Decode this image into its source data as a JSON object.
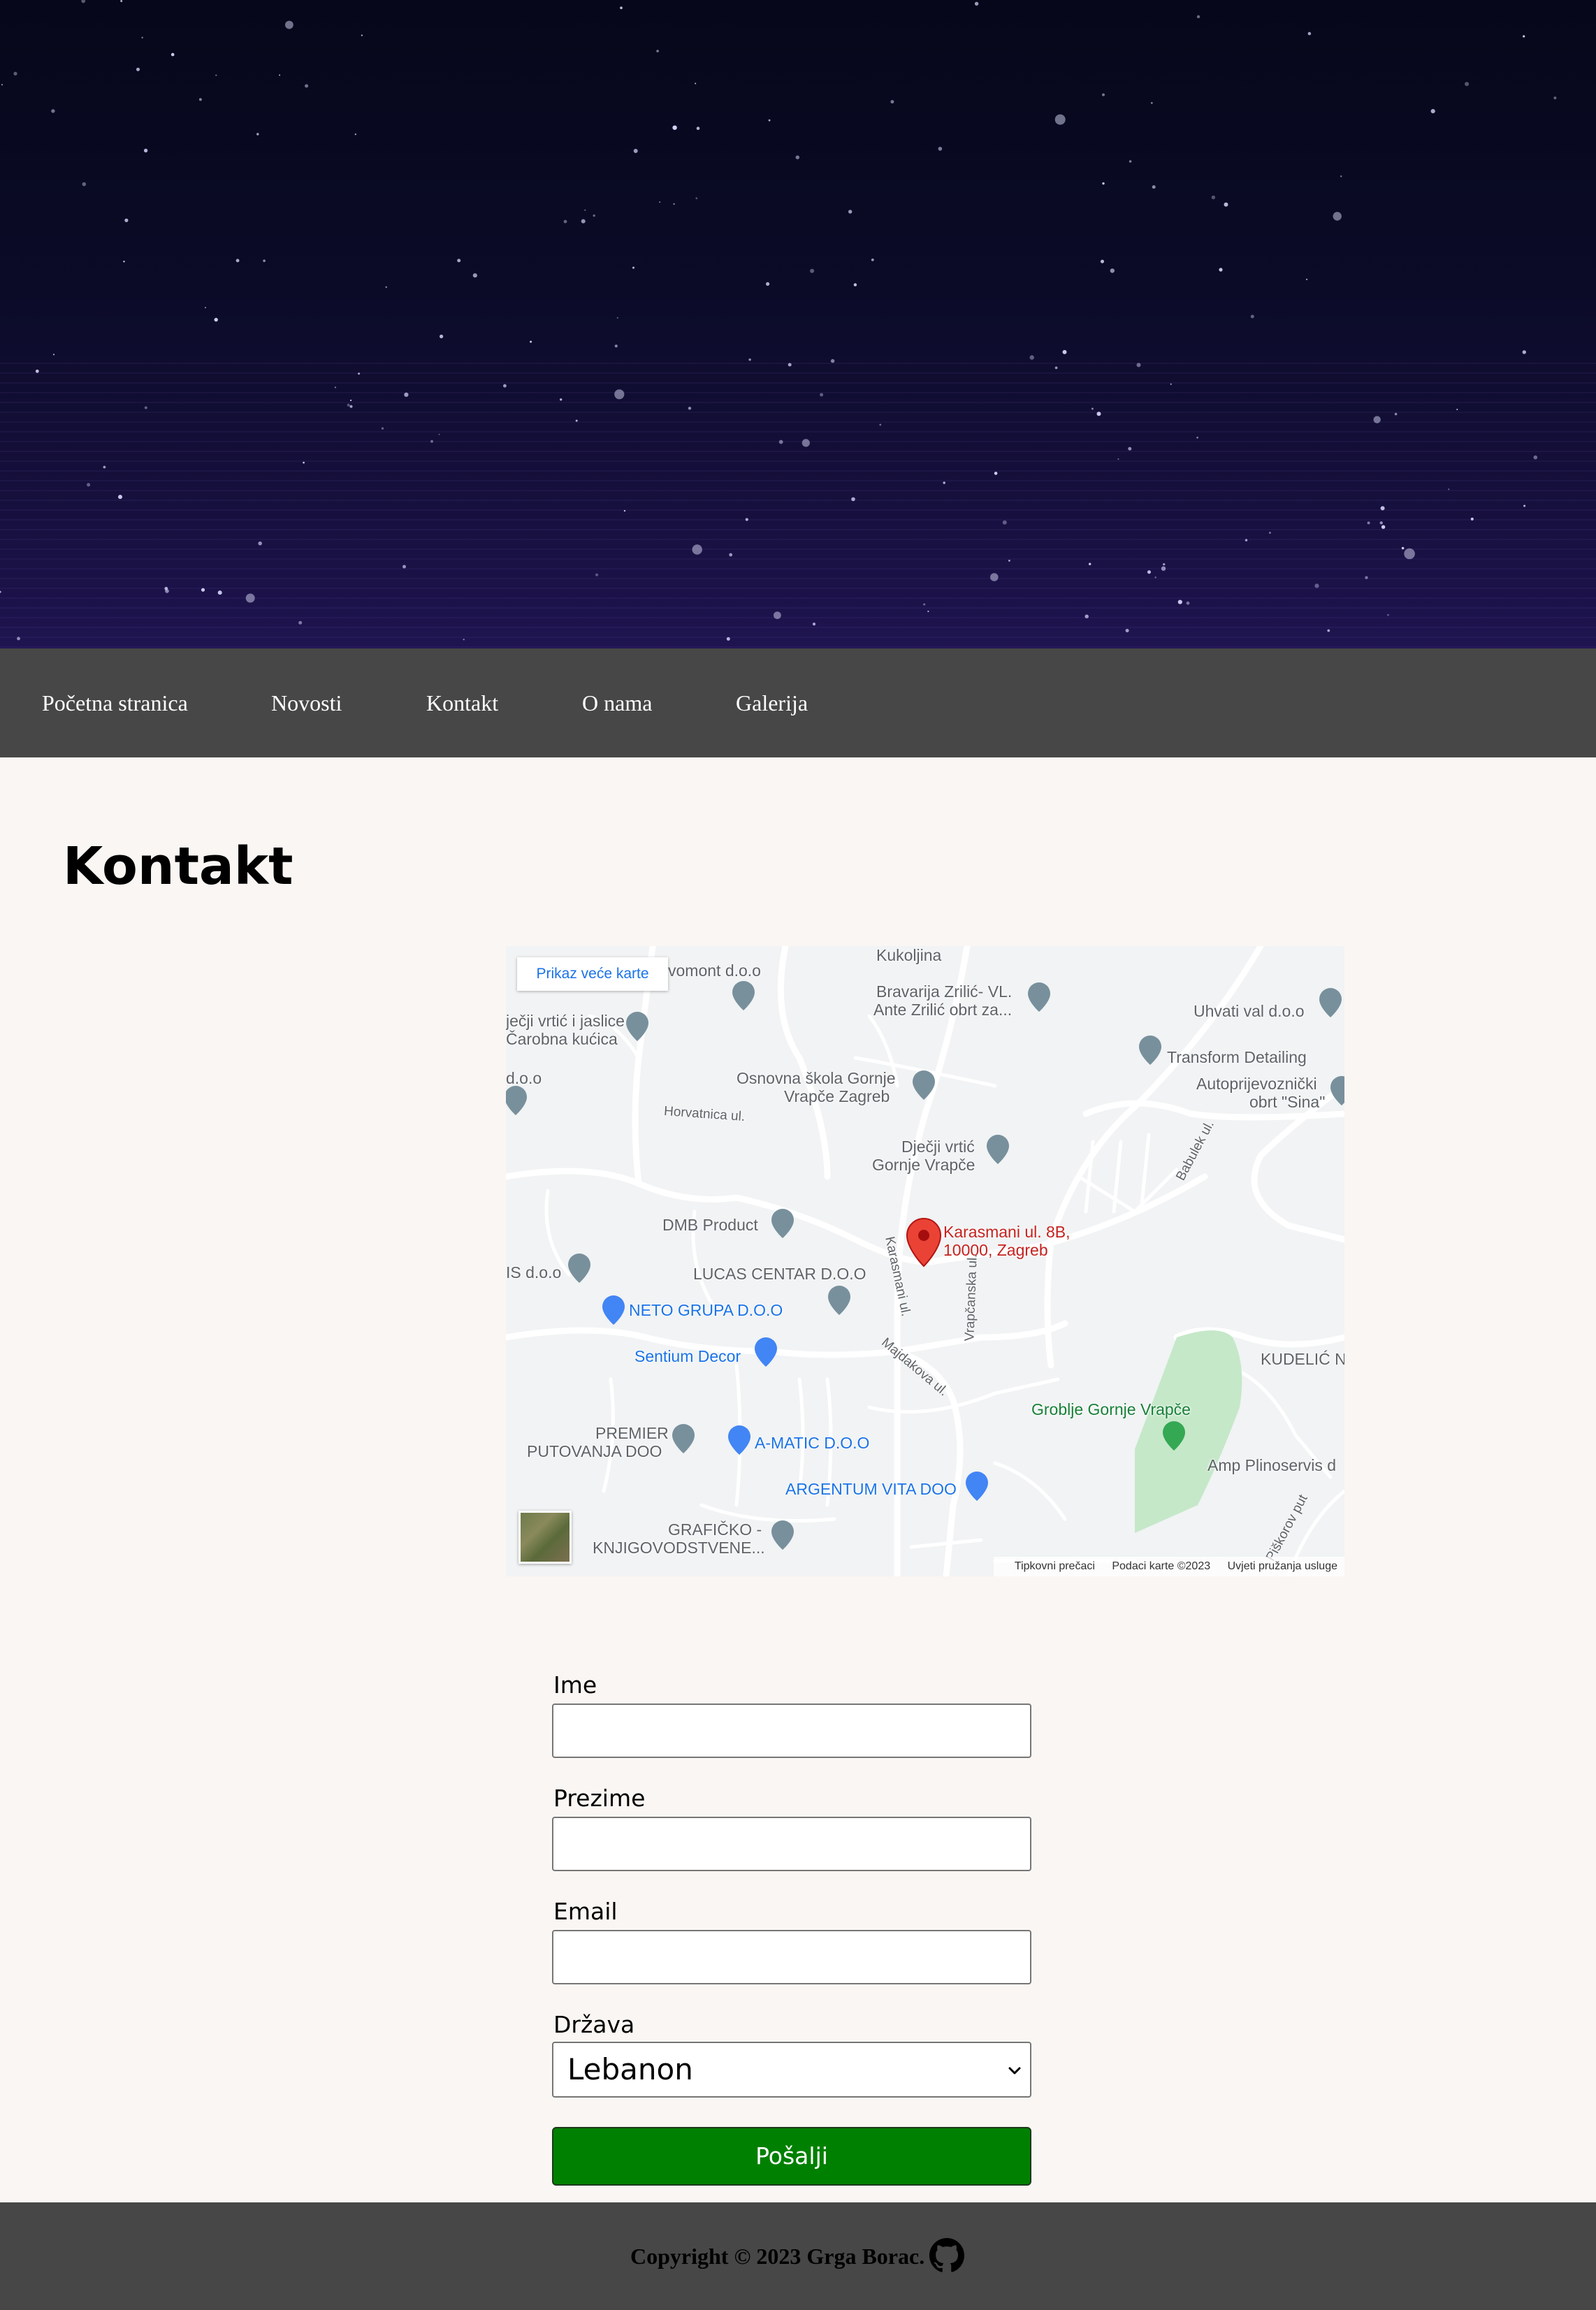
{
  "nav": {
    "items": [
      {
        "label": "Početna stranica"
      },
      {
        "label": "Novosti"
      },
      {
        "label": "Kontakt"
      },
      {
        "label": "O nama"
      },
      {
        "label": "Galerija"
      }
    ]
  },
  "page_title": "Kontakt",
  "map": {
    "larger_map_button": "Prikaz veće karte",
    "marker_address_line1": "Karasmani ul. 8B,",
    "marker_address_line2": "10000, Zagreb",
    "places": {
      "vomont": "vomont d.o.o",
      "kukoljina": "Kukoljina",
      "bravarija_1": "Bravarija Zrilić- VL.",
      "bravarija_2": "Ante Zrilić obrt za...",
      "uhvati": "Uhvati val d.o.o",
      "vrtic_1": "ječji vrtić i jaslice",
      "vrtic_2": "Čarobna kućica",
      "transform": "Transform Detailing",
      "doo": "d.o.o",
      "skola_1": "Osnovna škola Gornje",
      "skola_2": "Vrapče Zagreb",
      "autoprijevoz_1": "Autoprijevoznički",
      "autoprijevoz_2": "obrt \"Sina\"",
      "djecji_1": "Dječji vrtić",
      "djecji_2": "Gornje Vrapče",
      "dmb": "DMB Product",
      "sdoo": "IS d.o.o",
      "lucas": "LUCAS CENTAR D.O.O",
      "neto": "NETO GRUPA D.O.O",
      "sentium": "Sentium Decor",
      "kudelic": "KUDELIĆ NAMJ",
      "groblje": "Groblje Gornje Vrapče",
      "premier_1": "PREMIER",
      "premier_2": "PUTOVANJA DOO",
      "amatic": "A-MATIC D.O.O",
      "amp": "Amp Plinoservis d",
      "argentum": "ARGENTUM VITA DOO",
      "graficko_1": "GRAFIČKO -",
      "graficko_2": "KNJIGOVODSTVENE..."
    },
    "streets": {
      "horvatnica": "Horvatnica ul.",
      "babulek": "Babulek ul.",
      "karasmani": "Karasmani ul.",
      "vrapcanska": "Vrapčanska ul.",
      "majdakova": "Majdakova ul.",
      "piskorov": "Piškorov put"
    },
    "footer": {
      "shortcuts": "Tipkovni prečaci",
      "attribution": "Podaci karte ©2023",
      "terms": "Uvjeti pružanja usluge"
    }
  },
  "form": {
    "first_name_label": "Ime",
    "last_name_label": "Prezime",
    "email_label": "Email",
    "country_label": "Država",
    "country_value": "Lebanon",
    "submit_label": "Pošalji"
  },
  "footer": {
    "copyright": "Copyright © 2023 Grga Borac."
  },
  "colors": {
    "nav_bg": "#474747",
    "page_bg": "#faf6f3",
    "submit_bg": "#008000",
    "map_marker": "#ea4335"
  },
  "icons": [
    "github-icon",
    "map-pin-icon",
    "chevron-down-icon"
  ]
}
